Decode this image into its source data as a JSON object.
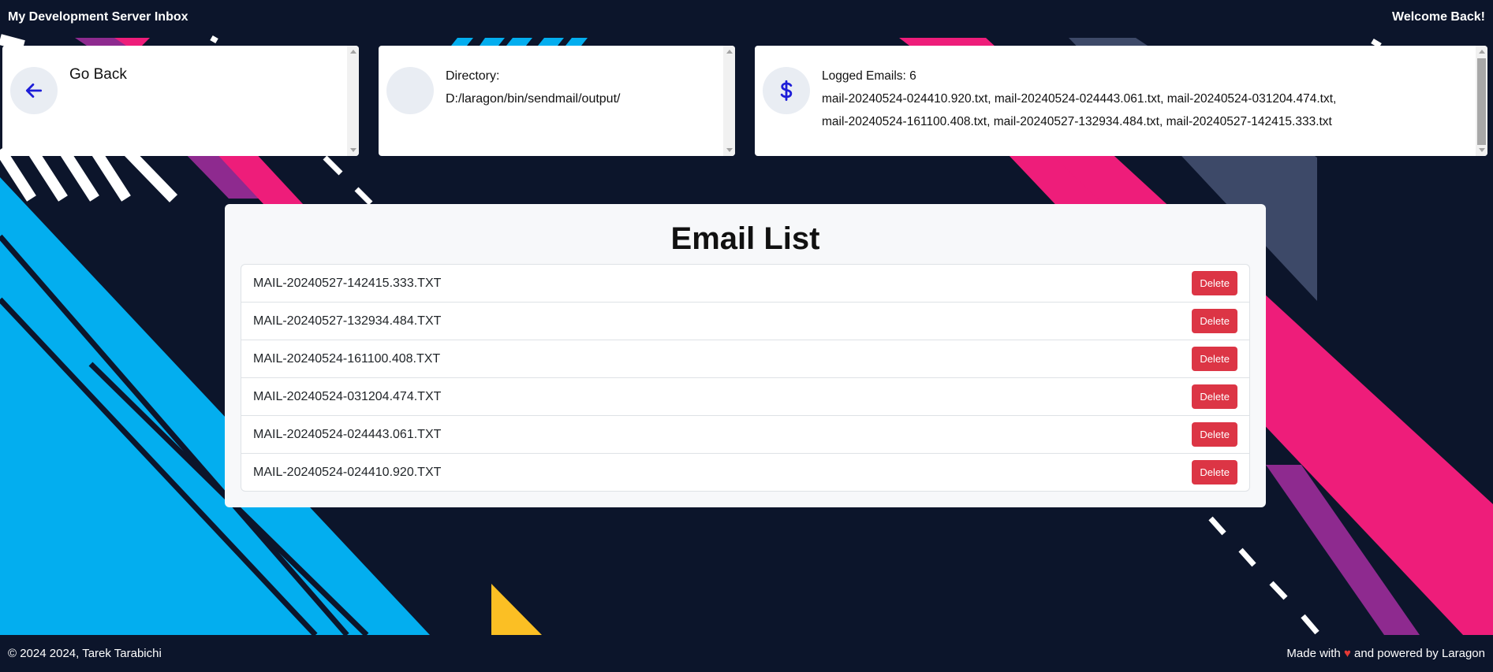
{
  "header": {
    "title": "My Development Server Inbox",
    "welcome": "Welcome Back!"
  },
  "cards": {
    "back": {
      "label": "Go Back",
      "icon": "arrow-left-icon"
    },
    "directory": {
      "label": "Directory:",
      "path": "D:/laragon/bin/sendmail/output/"
    },
    "logged": {
      "label": "Logged Emails: 6",
      "files_line1": "mail-20240524-024410.920.txt, mail-20240524-024443.061.txt, mail-20240524-031204.474.txt,",
      "files_line2": "mail-20240524-161100.408.txt, mail-20240527-132934.484.txt, mail-20240527-142415.333.txt",
      "icon": "dollar-icon"
    }
  },
  "email_list": {
    "title": "Email List",
    "delete_label": "Delete",
    "items": [
      "MAIL-20240527-142415.333.TXT",
      "MAIL-20240527-132934.484.TXT",
      "MAIL-20240524-161100.408.TXT",
      "MAIL-20240524-031204.474.TXT",
      "MAIL-20240524-024443.061.TXT",
      "MAIL-20240524-024410.920.TXT"
    ]
  },
  "footer": {
    "copyright": "© 2024 2024, Tarek Tarabichi",
    "made_with": "Made with",
    "heart": "♥",
    "powered": "and powered by Laragon"
  },
  "colors": {
    "background": "#0c152b",
    "accent_blue": "#03aeef",
    "accent_pink": "#ee1d7a",
    "accent_purple": "#8e2a8f",
    "accent_slate": "#3d4968",
    "accent_yellow": "#fbbf24",
    "delete": "#dc3545",
    "icon_blue": "#1d1dd8"
  }
}
